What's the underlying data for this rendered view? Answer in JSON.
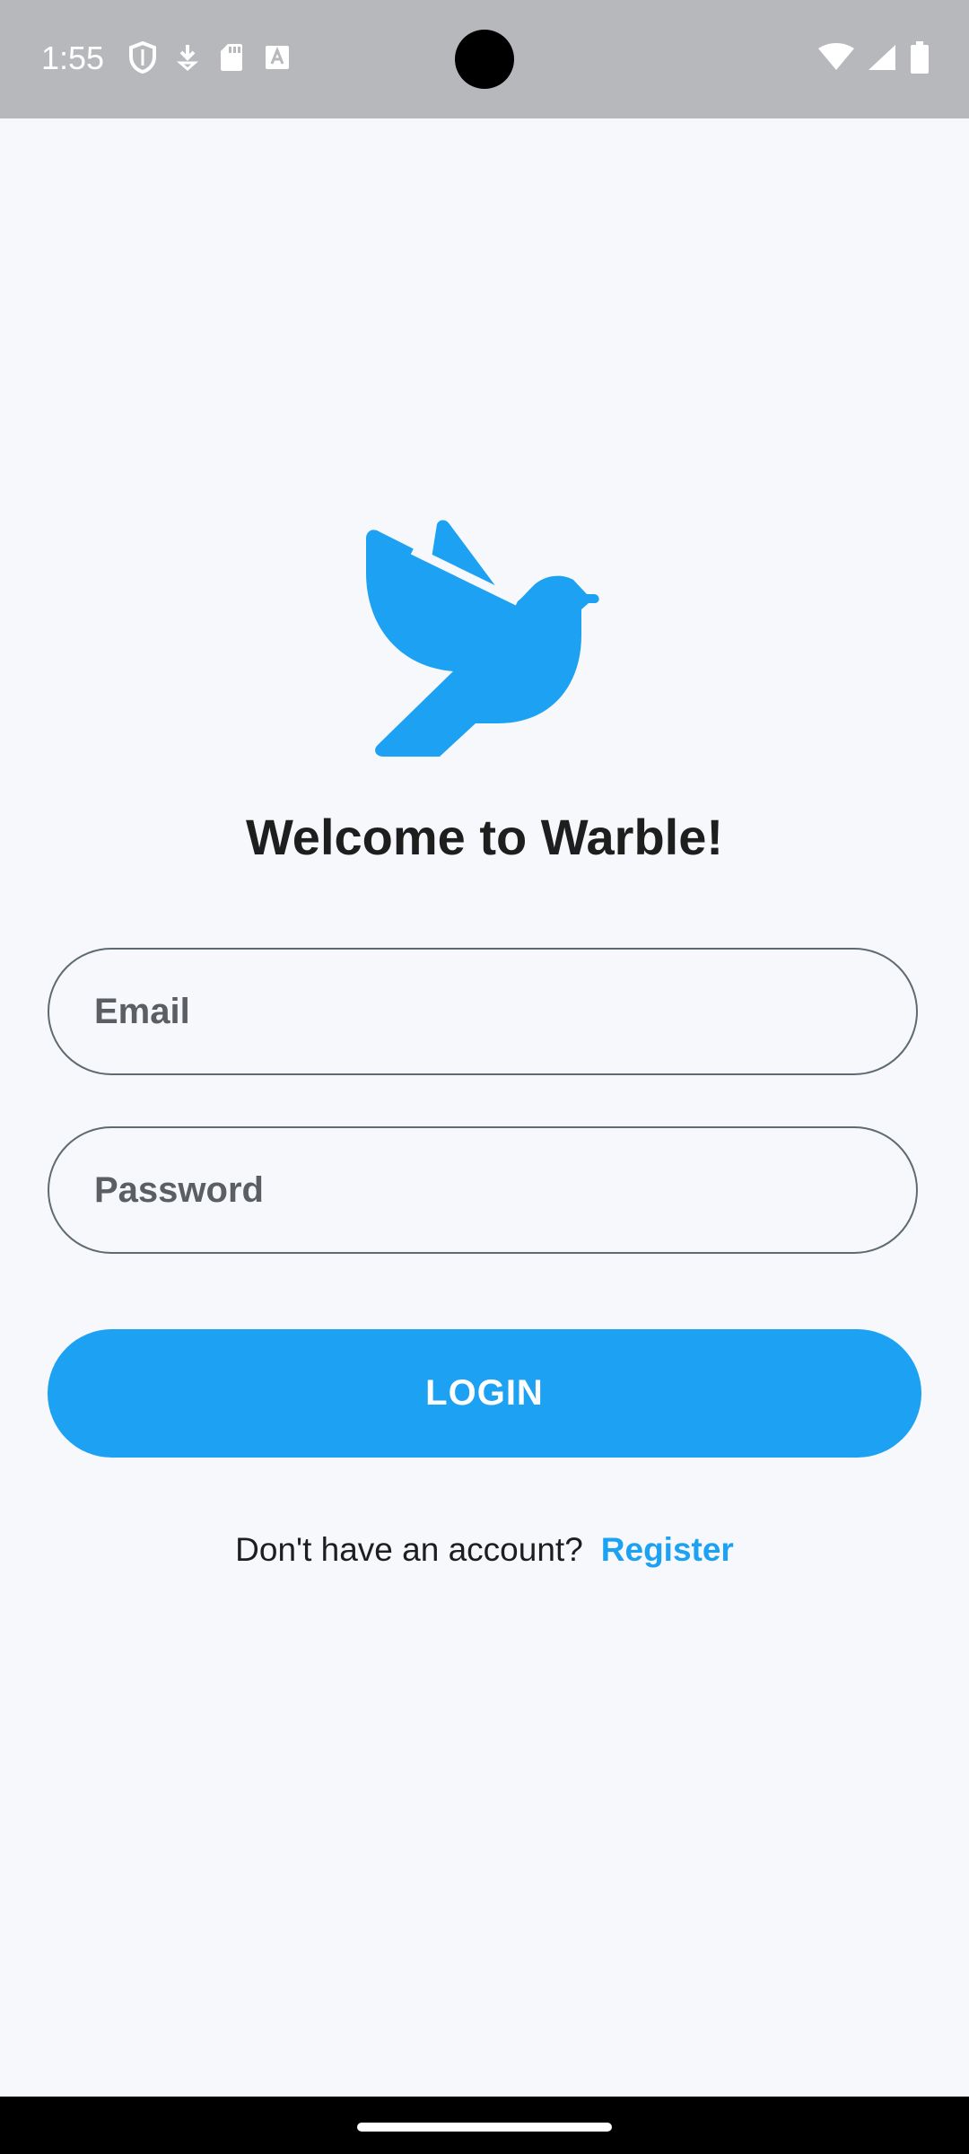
{
  "status_bar": {
    "time": "1:55",
    "left_icons": [
      "shield-icon",
      "download-icon",
      "sd-card-icon",
      "font-a-icon"
    ],
    "right_icons": [
      "wifi-icon",
      "cell-signal-icon",
      "battery-icon"
    ]
  },
  "logo": {
    "icon": "bird-icon",
    "color": "#1DA1F2"
  },
  "title": "Welcome to Warble!",
  "form": {
    "email_placeholder": "Email",
    "email_value": "",
    "password_placeholder": "Password",
    "password_value": "",
    "login_label": "LOGIN"
  },
  "register": {
    "prompt": "Don't have an account?",
    "link_label": "Register"
  },
  "colors": {
    "accent": "#1DA1F2",
    "background": "#F6F8FC",
    "status_bar": "#B7B8BC",
    "field_border": "#5F6B70",
    "title_text": "#1E1E1E"
  }
}
